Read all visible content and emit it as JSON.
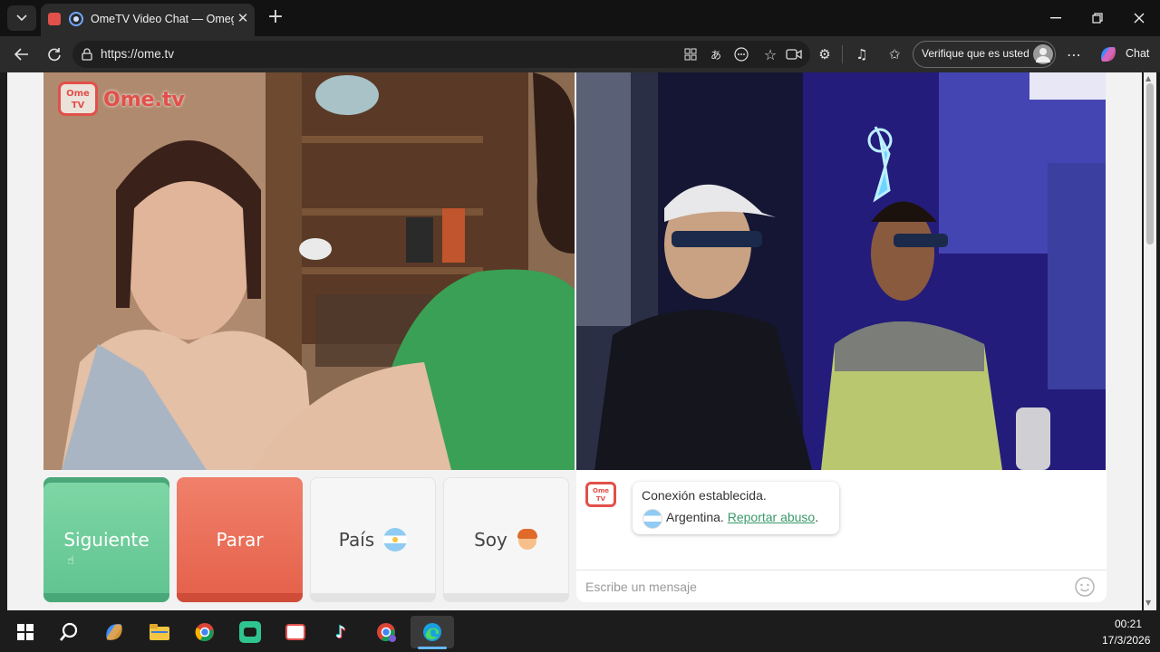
{
  "browser": {
    "tab": {
      "title": "OmeTV Video Chat — Omegle"
    },
    "address": {
      "url": "https://ome.tv"
    },
    "profile": {
      "verify_label": "Verifique que es usted"
    },
    "copilot": {
      "label": "Chat"
    }
  },
  "site": {
    "logo_badge": "Ome TV",
    "logo_text": "Ome.tv"
  },
  "controls": {
    "next_label": "Siguiente",
    "stop_label": "Parar",
    "country_label": "País",
    "gender_label": "Soy"
  },
  "chat": {
    "message_line1": "Conexión establecida.",
    "country": "Argentina.",
    "report_link": "Reportar abuso",
    "after_link": ".",
    "input_placeholder": "Escribe un mensaje"
  },
  "taskbar": {
    "time": "00:21",
    "date": "17/3/2026"
  },
  "colors": {
    "next_green": "#6fcf97",
    "stop_red": "#eb6f57",
    "link_green": "#3a9a6a",
    "brand_red": "#e2504a"
  }
}
